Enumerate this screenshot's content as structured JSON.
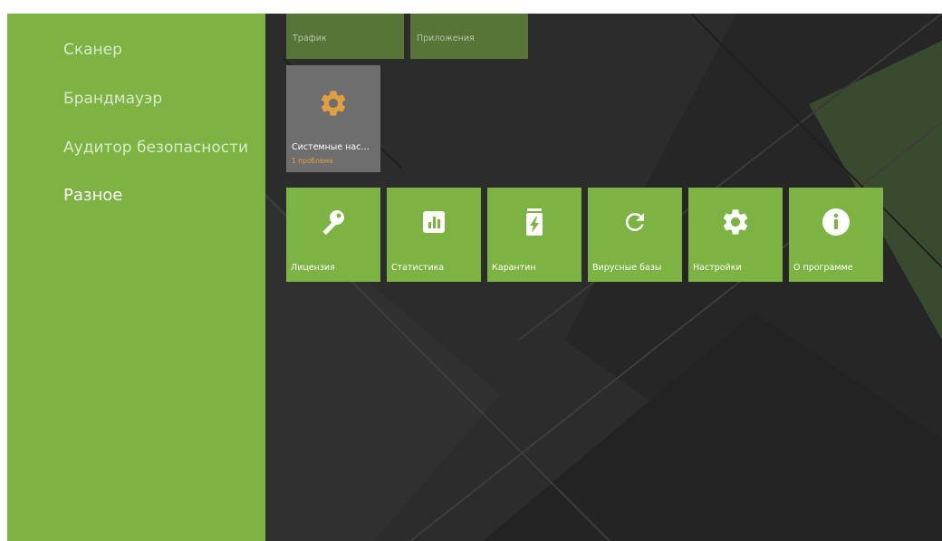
{
  "sidebar": {
    "items": [
      {
        "label": "Сканер"
      },
      {
        "label": "Брандмауэр"
      },
      {
        "label": "Аудитор безопасности"
      },
      {
        "label": "Разное"
      }
    ]
  },
  "top_tiles": [
    {
      "label": "Трафик"
    },
    {
      "label": "Приложения"
    }
  ],
  "system_tile": {
    "label": "Системные нас…",
    "subtitle": "1 проблема",
    "icon": "gear-icon"
  },
  "tiles": [
    {
      "label": "Лицензия",
      "icon": "key-icon"
    },
    {
      "label": "Статистика",
      "icon": "bar-chart-icon"
    },
    {
      "label": "Карантин",
      "icon": "quarantine-jar-icon"
    },
    {
      "label": "Вирусные базы",
      "icon": "refresh-icon"
    },
    {
      "label": "Настройки",
      "icon": "gear-icon"
    },
    {
      "label": "О программе",
      "icon": "info-icon"
    }
  ],
  "colors": {
    "accent": "#7cb342",
    "background": "#2c2c2c",
    "warning": "#e0a040",
    "inactive_tile": "#6e6e6e"
  }
}
